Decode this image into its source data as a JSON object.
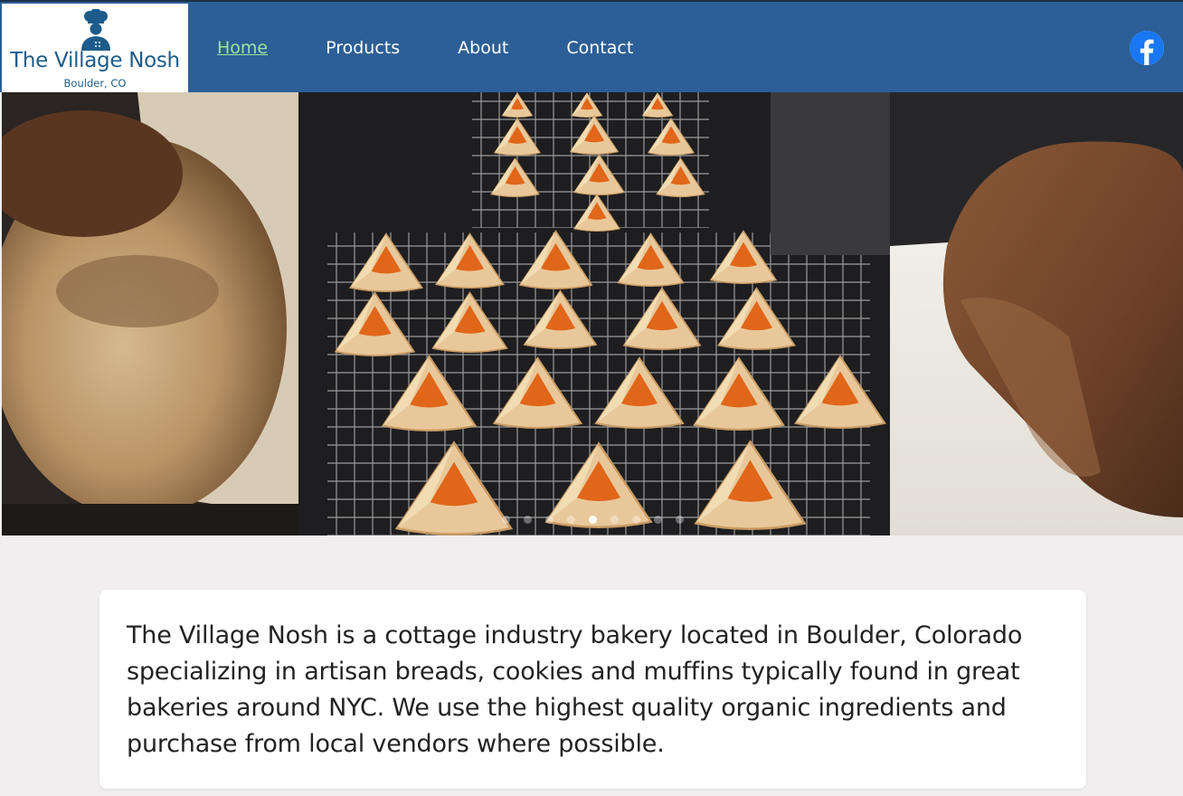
{
  "brand": {
    "name": "The Village Nosh",
    "location": "Boulder, CO",
    "logo_icon": "chef-icon"
  },
  "nav": {
    "items": [
      {
        "label": "Home",
        "active": true
      },
      {
        "label": "Products",
        "active": false
      },
      {
        "label": "About",
        "active": false
      },
      {
        "label": "Contact",
        "active": false
      }
    ],
    "social_icon": "facebook-icon"
  },
  "hero": {
    "slides": [
      {
        "subject": "crumb cake"
      },
      {
        "subject": "hamantaschen on cooling racks"
      },
      {
        "subject": "rye bread loaf"
      }
    ],
    "dot_count": 9,
    "active_dot": 5
  },
  "about": {
    "text": "The Village Nosh is a cottage industry bakery located in Boulder, Colorado specializing in artisan breads, cookies and muffins typically found in great bakeries around NYC. We use the highest quality organic ingredients and purchase from local vendors where possible."
  },
  "colors": {
    "header_bg": "#2c5f97",
    "nav_active": "#9ee29c",
    "page_bg": "#f0eeee",
    "brand_text": "#1d5c8a",
    "facebook": "#1877f2"
  }
}
